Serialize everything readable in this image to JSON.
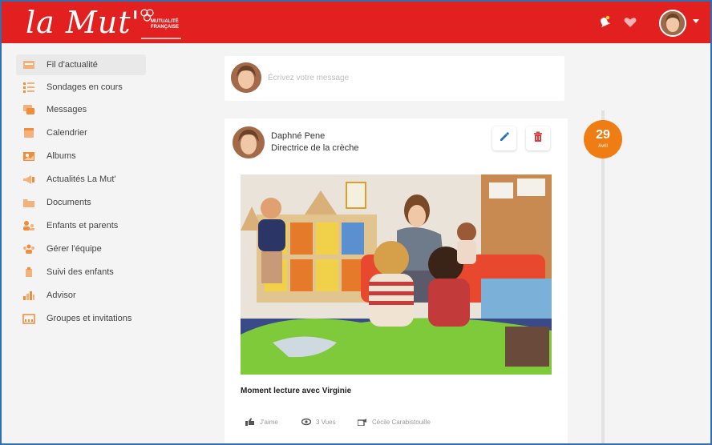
{
  "header": {
    "logo_text": "la Mut'",
    "partner_logo_text": "Mutualité Française",
    "notifications_icon": "bell-icon",
    "favorites_icon": "heart-icon",
    "colors": {
      "brand_red": "#e32020",
      "accent_orange": "#f07c14"
    }
  },
  "sidebar": {
    "items": [
      {
        "label": "Fil d'actualité",
        "icon": "news-feed-icon",
        "active": true
      },
      {
        "label": "Sondages en cours",
        "icon": "polls-icon"
      },
      {
        "label": "Messages",
        "icon": "messages-icon"
      },
      {
        "label": "Calendrier",
        "icon": "calendar-icon"
      },
      {
        "label": "Albums",
        "icon": "albums-icon"
      },
      {
        "label": "Actualités La Mut'",
        "icon": "announcements-icon"
      },
      {
        "label": "Documents",
        "icon": "documents-icon"
      },
      {
        "label": "Enfants et parents",
        "icon": "children-parents-icon"
      },
      {
        "label": "Gérer l'équipe",
        "icon": "team-icon"
      },
      {
        "label": "Suivi des enfants",
        "icon": "child-tracking-icon"
      },
      {
        "label": "Advisor",
        "icon": "advisor-icon"
      },
      {
        "label": "Groupes et invitations",
        "icon": "groups-icon"
      }
    ]
  },
  "composer": {
    "placeholder": "Écrivez votre message"
  },
  "post": {
    "author": "Daphné Pene",
    "role": "Directrice de la crèche",
    "caption": "Moment lecture avec Virginie",
    "actions": {
      "like": "J'aime",
      "views": "3 Vues",
      "share": "Cécile Carabistouille"
    }
  },
  "timeline": {
    "day": "29",
    "month": "Avril"
  }
}
